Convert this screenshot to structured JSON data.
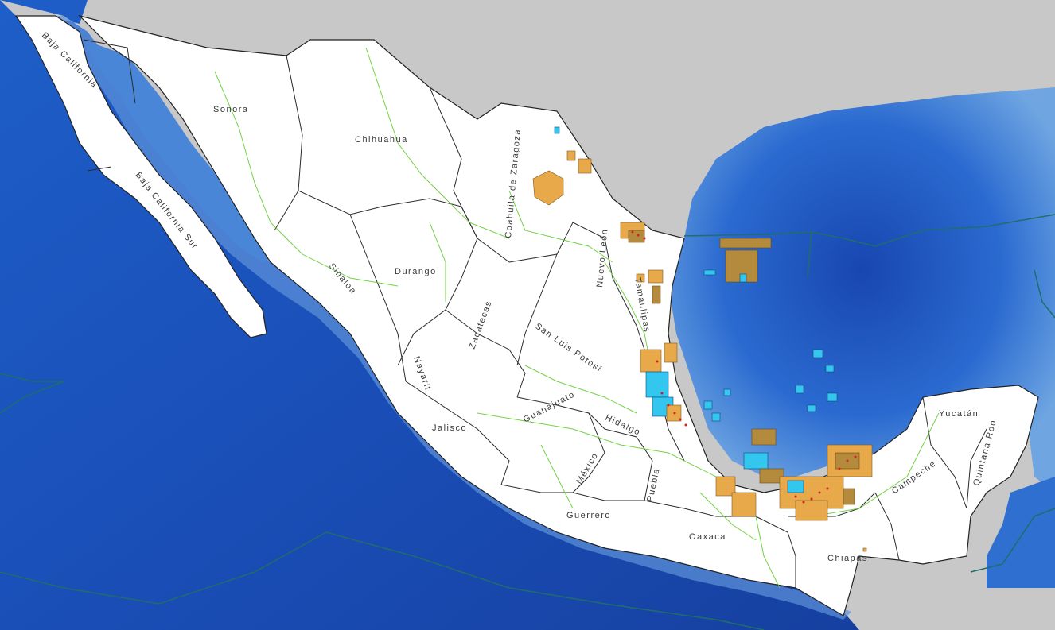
{
  "map": {
    "colors": {
      "ocean_deep": "#1a4fb8",
      "ocean_shallow": "#7fb0e6",
      "neighbor_land": "#c8c8c8",
      "mexico_land": "#ffffff",
      "roads": "#66cc33",
      "eez_line": "#1f6e6a",
      "block_orange": "#e8a94a",
      "block_tan": "#b48a3c",
      "block_cyan": "#33c6ee",
      "wells_red": "#d42020"
    },
    "states": [
      "Baja California",
      "Baja California Sur",
      "Sonora",
      "Chihuahua",
      "Coahuila de Zaragoza",
      "Nuevo León",
      "Tamaulipas",
      "Sinaloa",
      "Durango",
      "Zacatecas",
      "San Luis Potosí",
      "Nayarit",
      "Jalisco",
      "Guanajuato",
      "Hidalgo",
      "México",
      "Puebla",
      "Guerrero",
      "Oaxaca",
      "Chiapas",
      "Campeche",
      "Yucatán",
      "Quintana Roo"
    ]
  }
}
